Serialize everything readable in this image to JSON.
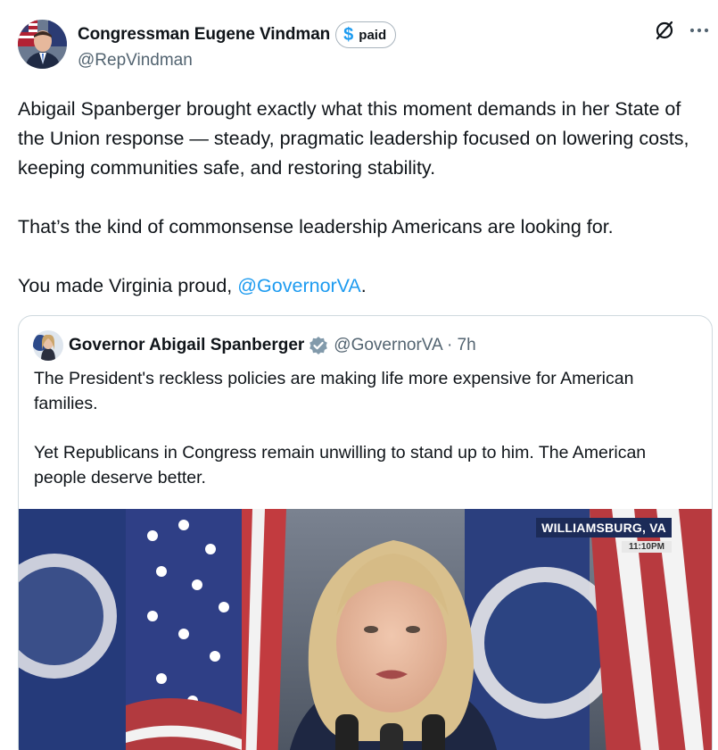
{
  "post": {
    "author": {
      "display_name": "Congressman Eugene Vindman",
      "handle": "@RepVindman",
      "badge": {
        "symbol": "$",
        "label": "paid"
      }
    },
    "text": {
      "p1": "Abigail Spanberger brought exactly what this moment demands in her State of the Union response — steady, pragmatic leadership focused on lowering costs, keeping communities safe, and restoring stability.",
      "p2": "That’s the kind of commonsense leadership Americans are looking for.",
      "p3_prefix": "You made Virginia proud, ",
      "p3_mention": "@GovernorVA",
      "p3_suffix": "."
    },
    "actions": {
      "grok_icon": "slash-circle-icon",
      "more_icon": "ellipsis-icon"
    }
  },
  "quote": {
    "author": {
      "display_name": "Governor Abigail Spanberger",
      "handle_time": "@GovernorVA · 7h"
    },
    "text": {
      "p1": "The President's reckless policies are making life more expensive for American families.",
      "p2": "Yet Republicans in Congress remain unwilling to stand up to him. The American people deserve better."
    },
    "media": {
      "chyron_location": "WILLIAMSBURG, VA",
      "chyron_time": "11:10PM"
    }
  },
  "colors": {
    "link": "#1d9bf0",
    "secondary_text": "#536471",
    "border": "#cfd9de",
    "verified_gold": "#c9a227"
  }
}
